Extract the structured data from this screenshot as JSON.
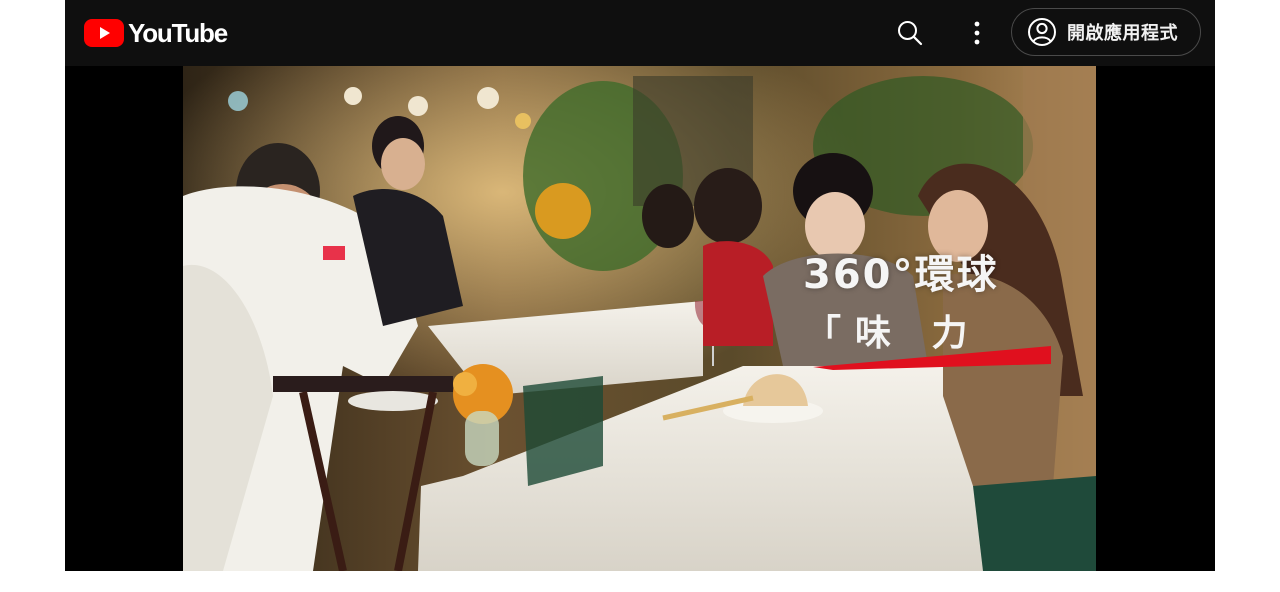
{
  "header": {
    "logo_text": "YouTube",
    "open_app_label": "開啟應用程式",
    "icons": {
      "logo": "youtube-logo-icon",
      "search": "search-icon",
      "more": "more-vertical-icon",
      "account": "account-circle-icon"
    },
    "colors": {
      "background": "#0f0f0f",
      "brand_red": "#ff0000",
      "text": "#f1f1f1"
    }
  },
  "video": {
    "overlay": {
      "title": "360°環球",
      "subtitle": "「味 力",
      "accent_color": "#e0101e"
    }
  }
}
